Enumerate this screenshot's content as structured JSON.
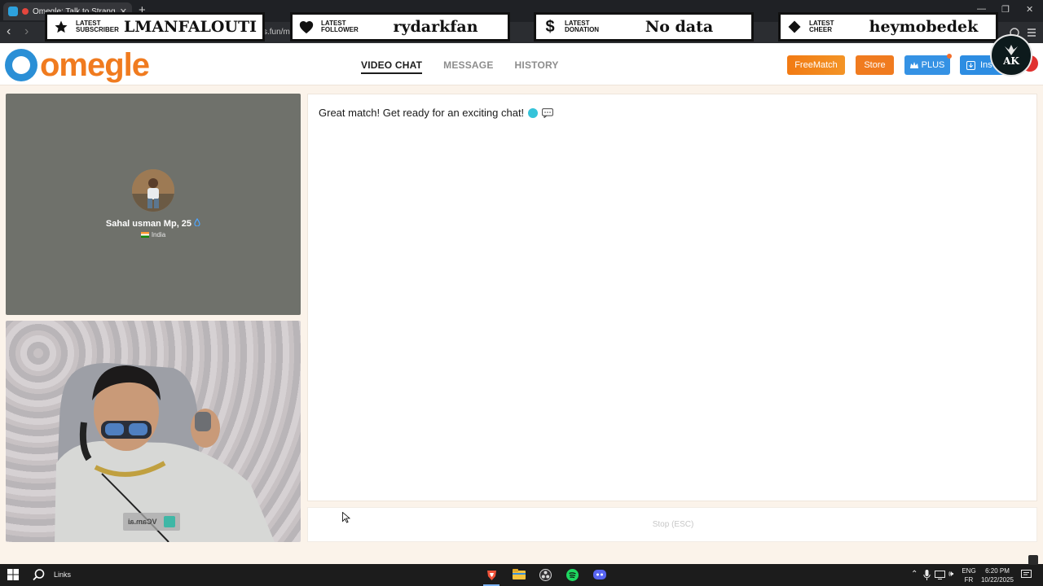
{
  "browser": {
    "tab_title": "Omegle: Talk to Strangers wi",
    "tab_close": "✕",
    "new_tab": "+",
    "url_fragment": "s.fun/m",
    "controls": {
      "minimize": "—",
      "restore": "❐",
      "close": "✕"
    }
  },
  "overlay": {
    "subscriber": {
      "label_line1": "LATEST",
      "label_line2": "SUBSCRIBER",
      "value": "LMANFALOUTI"
    },
    "follower": {
      "label_line1": "LATEST",
      "label_line2": "FOLLOWER",
      "value": "rydarkfan"
    },
    "donation": {
      "label_line1": "LATEST",
      "label_line2": "DONATION",
      "value": "No data"
    },
    "cheer": {
      "label_line1": "LATEST",
      "label_line2": "CHEER",
      "value": "heymobedek"
    },
    "channel_logo_text": "AK"
  },
  "site": {
    "logo_text": "omegle",
    "nav": [
      {
        "label": "VIDEO CHAT",
        "active": true
      },
      {
        "label": "MESSAGE",
        "active": false
      },
      {
        "label": "HISTORY",
        "active": false
      }
    ],
    "buttons": {
      "freematch": "FreeMatch",
      "store": "Store",
      "plus": "PLUS",
      "install": "Ins"
    }
  },
  "stranger": {
    "name": "Sahal usman Mp, 25",
    "country": "India"
  },
  "local_video": {
    "tag_text": "VCam.ai"
  },
  "chat": {
    "messages": [
      {
        "text": "Great match! Get ready for an exciting chat!"
      }
    ],
    "stop_label": "Stop",
    "stop_hint": "(ESC)"
  },
  "taskbar": {
    "search_label": "Links",
    "lang_line1": "ENG",
    "lang_line2": "FR",
    "time": "6:20 PM",
    "date": "10/22/2025"
  },
  "colors": {
    "brand_orange": "#f07b1f",
    "brand_blue": "#2a8fd6",
    "plus_blue": "#3592e4"
  }
}
